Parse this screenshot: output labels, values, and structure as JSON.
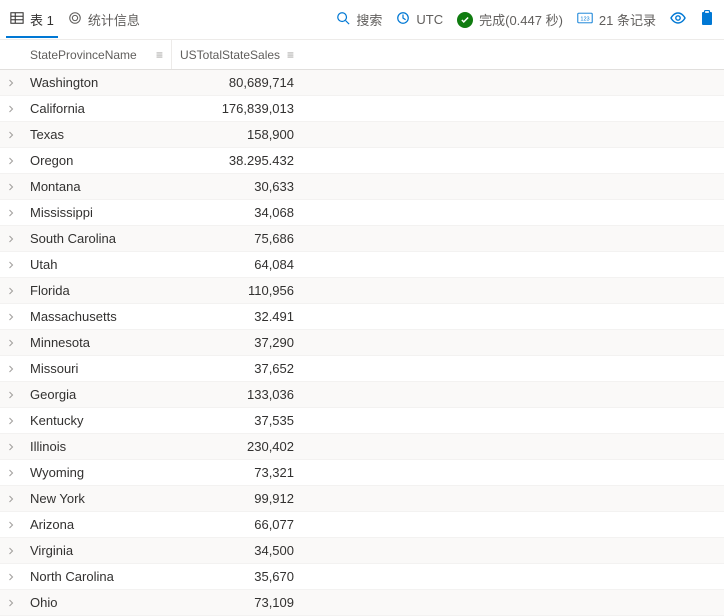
{
  "toolbar": {
    "tab1_label": "表 1",
    "stats_label": "统计信息",
    "search_label": "搜索",
    "tz_label": "UTC",
    "done_label": "完成(0.447 秒)",
    "records_label": "21 条记录"
  },
  "columns": {
    "state": "StateProvinceName",
    "sales": "USTotalStateSales"
  },
  "rows": [
    {
      "state": "Washington",
      "sales": "80,689,714"
    },
    {
      "state": "California",
      "sales": "176,839,013"
    },
    {
      "state": "Texas",
      "sales": "158,900"
    },
    {
      "state": "Oregon",
      "sales": "38.295.432"
    },
    {
      "state": "Montana",
      "sales": "30,633"
    },
    {
      "state": "Mississippi",
      "sales": "34,068"
    },
    {
      "state": "South Carolina",
      "sales": "75,686"
    },
    {
      "state": "Utah",
      "sales": "64,084"
    },
    {
      "state": "Florida",
      "sales": "110,956"
    },
    {
      "state": "Massachusetts",
      "sales": "32.491"
    },
    {
      "state": "Minnesota",
      "sales": "37,290"
    },
    {
      "state": "Missouri",
      "sales": "37,652"
    },
    {
      "state": "Georgia",
      "sales": "133,036"
    },
    {
      "state": "Kentucky",
      "sales": "37,535"
    },
    {
      "state": "Illinois",
      "sales": "230,402"
    },
    {
      "state": "Wyoming",
      "sales": "73,321"
    },
    {
      "state": "New York",
      "sales": "99,912"
    },
    {
      "state": "Arizona",
      "sales": "66,077"
    },
    {
      "state": "Virginia",
      "sales": "34,500"
    },
    {
      "state": "North Carolina",
      "sales": "35,670"
    },
    {
      "state": "Ohio",
      "sales": "73,109"
    }
  ]
}
